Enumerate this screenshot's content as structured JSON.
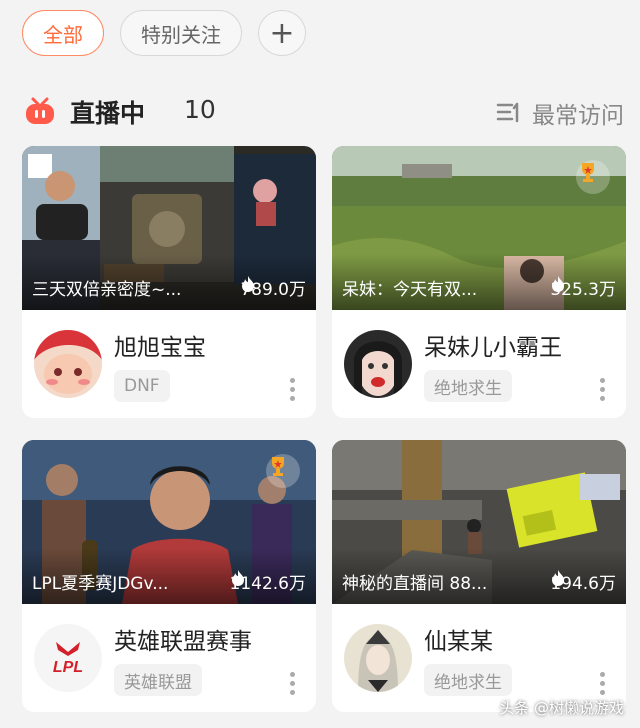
{
  "tabs": {
    "all": "全部",
    "followed": "特别关注",
    "add": "+"
  },
  "section": {
    "title": "直播中",
    "count": "10",
    "sort_label": "最常访问"
  },
  "colors": {
    "accent": "#ff6a39",
    "live_icon": "#ff5a4a"
  },
  "cards": [
    {
      "title": "三天双倍亲密度~...",
      "heat": "789.0万",
      "name": "旭旭宝宝",
      "category": "DNF",
      "trophy": false
    },
    {
      "title": "呆妹：今天有双...",
      "heat": "325.3万",
      "name": "呆妹儿小霸王",
      "category": "绝地求生",
      "trophy": true
    },
    {
      "title": "LPL夏季赛JDGv...",
      "heat": "1142.6万",
      "name": "英雄联盟赛事",
      "category": "英雄联盟",
      "trophy": true,
      "avatar_text": "LPL"
    },
    {
      "title": "神秘的直播间 88...",
      "heat": "194.6万",
      "name": "仙某某",
      "category": "绝地求生",
      "trophy": false
    }
  ],
  "watermark": "头条 @树懒说游戏"
}
